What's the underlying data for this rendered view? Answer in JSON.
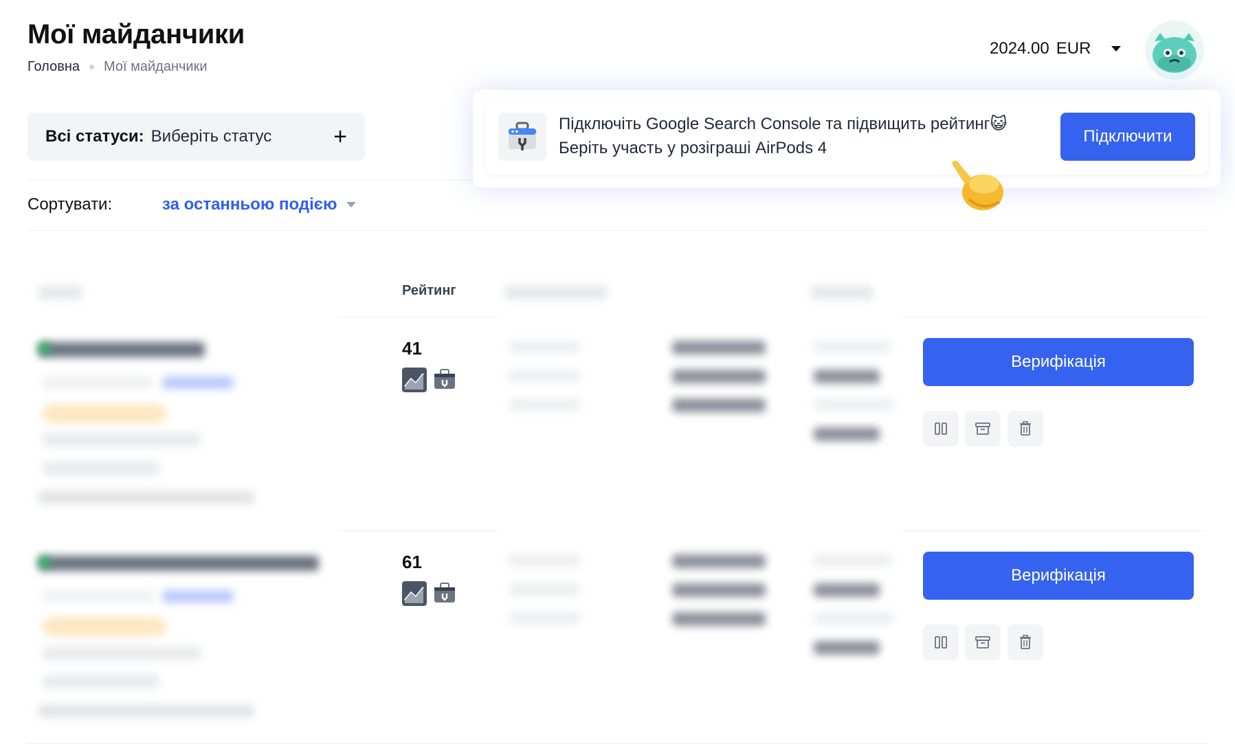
{
  "header": {
    "title": "Мої майданчики",
    "breadcrumb": {
      "home": "Головна",
      "current": "Мої майданчики"
    },
    "balance": {
      "amount": "2024.00",
      "currency": "EUR"
    }
  },
  "filter": {
    "label": "Всі статуси:",
    "value": "Виберіть статус",
    "add_symbol": "+"
  },
  "sort": {
    "label": "Сортувати:",
    "value": "за останньою подією"
  },
  "table": {
    "rating_header": "Рейтинг",
    "rows": [
      {
        "rating": "41",
        "verify_label": "Верифікація"
      },
      {
        "rating": "61",
        "verify_label": "Верифікація"
      }
    ]
  },
  "promo": {
    "line1": "Підключіть Google Search Console та підвищить рейтинг",
    "emoji": "😺",
    "line2": "Беріть участь у розіграші AirPods 4",
    "button": "Підключити"
  },
  "colors": {
    "primary": "#3563f0",
    "muted_bg": "#f3f4f6"
  }
}
